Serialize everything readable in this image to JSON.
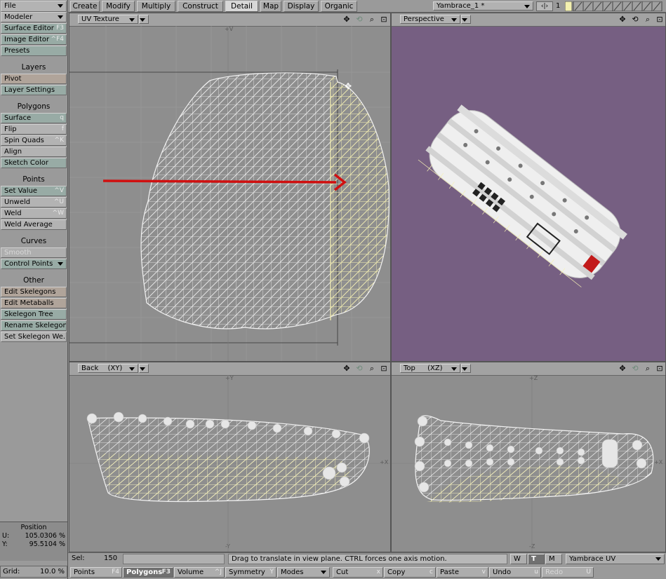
{
  "left_menu": {
    "file": "File",
    "modeler": "Modeler",
    "surface_editor": {
      "label": "Surface Editor",
      "shortcut": "F3"
    },
    "image_editor": {
      "label": "Image Editor",
      "shortcut": "^F4"
    },
    "presets": "Presets",
    "layers_head": "Layers",
    "pivot": "Pivot",
    "layer_settings": "Layer Settings",
    "polygons_head": "Polygons",
    "surface": {
      "label": "Surface",
      "shortcut": "q"
    },
    "flip": {
      "label": "Flip",
      "shortcut": "f"
    },
    "spin_quads": {
      "label": "Spin Quads",
      "shortcut": "^K"
    },
    "align": "Align",
    "sketch_color": "Sketch Color",
    "points_head": "Points",
    "set_value": {
      "label": "Set Value",
      "shortcut": "^V"
    },
    "unweld": {
      "label": "Unweld",
      "shortcut": "^U"
    },
    "weld": {
      "label": "Weld",
      "shortcut": "^W"
    },
    "weld_average": "Weld Average",
    "curves_head": "Curves",
    "smooth": "Smooth",
    "control_points": "Control Points",
    "other_head": "Other",
    "edit_skelegons": "Edit Skelegons",
    "edit_metaballs": "Edit Metaballs",
    "skelegon_tree": "Skelegon Tree",
    "rename_skelegon": "Rename Skelegon",
    "set_skelegon_weight": "Set Skelegon We..."
  },
  "position": {
    "title": "Position",
    "u_label": "U:",
    "u_value": "105.0306 %",
    "v_label": "Y:",
    "v_value": "95.5104 %"
  },
  "grid": {
    "label": "Grid:",
    "value": "10.0 %"
  },
  "tabs": [
    "Create",
    "Modify",
    "Multiply",
    "Construct",
    "Detail",
    "Map",
    "Display",
    "Organic"
  ],
  "active_tab": "Detail",
  "object": {
    "name": "Yambrace_1 *",
    "layer_number": "1"
  },
  "viewports": {
    "uv": {
      "mode": "UV Texture",
      "axis_top": "+V"
    },
    "perspective": {
      "mode": "Perspective"
    },
    "back": {
      "mode": "Back",
      "axes": "(XY)",
      "axis_top": "+Y",
      "axis_right": "+X",
      "axis_bottom": "-Y"
    },
    "top": {
      "mode": "Top",
      "axes": "(XZ)",
      "axis_top": "+Z",
      "axis_right": "+X",
      "axis_bottom": "-Z"
    }
  },
  "status": {
    "sel_label": "Sel:",
    "sel_value": "150",
    "message": "Drag to translate in view plane. CTRL forces one axis motion.",
    "w": "W",
    "t": "T",
    "m": "M",
    "uv_map": "Yambrace UV"
  },
  "bottom_bar": {
    "points": {
      "label": "Points",
      "shortcut": "F4"
    },
    "polygons": {
      "label": "Polygons",
      "shortcut": "F3"
    },
    "volume": {
      "label": "Volume",
      "shortcut": "^J"
    },
    "symmetry": {
      "label": "Symmetry",
      "shortcut": "Y"
    },
    "modes": "Modes",
    "cut": {
      "label": "Cut",
      "shortcut": "x"
    },
    "copy": {
      "label": "Copy",
      "shortcut": "c"
    },
    "paste": {
      "label": "Paste",
      "shortcut": "v"
    },
    "undo": {
      "label": "Undo",
      "shortcut": "u"
    },
    "redo": {
      "label": "Redo",
      "shortcut": "U"
    }
  },
  "colors": {
    "perspective_bg": "#765f82",
    "viewport_bg": "#8e8e8e",
    "wire_white": "#f2f2f2",
    "wire_selected": "#f7f2b4",
    "arrow_red": "#d01010"
  }
}
